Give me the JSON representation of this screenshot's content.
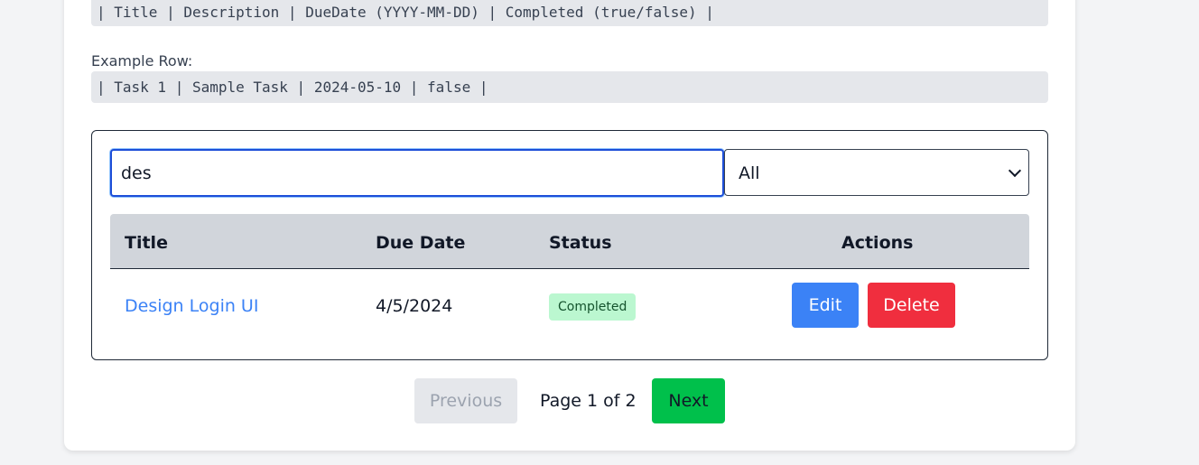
{
  "format": {
    "header_row": "| Title | Description | DueDate (YYYY-MM-DD) | Completed (true/false) |",
    "example_label": "Example Row:",
    "example_row": "| Task 1 | Sample Task | 2024-05-10 | false |"
  },
  "filters": {
    "search_value": "des",
    "status_selected": "All"
  },
  "table": {
    "columns": [
      "Title",
      "Due Date",
      "Status",
      "Actions"
    ],
    "rows": [
      {
        "title": "Design Login UI",
        "due_date": "4/5/2024",
        "status": "Completed",
        "edit_label": "Edit",
        "delete_label": "Delete"
      }
    ]
  },
  "pagination": {
    "previous_label": "Previous",
    "info": "Page 1 of 2",
    "next_label": "Next"
  },
  "colors": {
    "accent": "#3b82f6",
    "danger": "#f02e3e",
    "success": "#00c04b",
    "badge_bg": "#bbf7d0"
  }
}
